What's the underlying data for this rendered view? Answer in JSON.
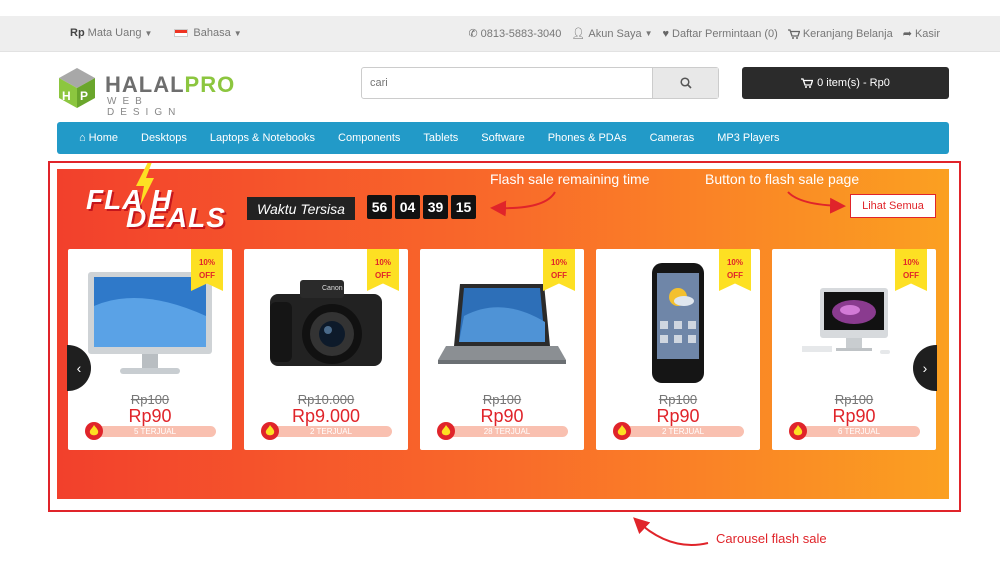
{
  "topbar": {
    "currency_symbol": "Rp",
    "currency_label": "Mata Uang",
    "language_label": "Bahasa",
    "phone": "0813-5883-3040",
    "account": "Akun Saya",
    "wishlist": "Daftar Permintaan (0)",
    "cart_link": "Keranjang Belanja",
    "checkout": "Kasir"
  },
  "logo": {
    "name_part1": "HALAL",
    "name_part2": "PRO",
    "tagline": "WEB DESIGN"
  },
  "search": {
    "placeholder": "cari"
  },
  "cart": {
    "label": "0 item(s) - Rp0"
  },
  "nav": [
    "Home",
    "Desktops",
    "Laptops & Notebooks",
    "Components",
    "Tablets",
    "Software",
    "Phones & PDAs",
    "Cameras",
    "MP3 Players"
  ],
  "flash_sale": {
    "logo_line1": "FLA  H",
    "logo_line2": "DEALS",
    "remaining_label": "Waktu Tersisa",
    "timer": [
      "56",
      "04",
      "39",
      "15"
    ],
    "see_all": "Lihat Semua",
    "products": [
      {
        "image": "monitor-image",
        "discount": "10%",
        "discount_suffix": "OFF",
        "old_price": "Rp100",
        "price": "Rp90",
        "sold": "5 TERJUAL"
      },
      {
        "image": "camera-image",
        "discount": "10%",
        "discount_suffix": "OFF",
        "old_price": "Rp10.000",
        "price": "Rp9.000",
        "sold": "2 TERJUAL"
      },
      {
        "image": "laptop-image",
        "discount": "10%",
        "discount_suffix": "OFF",
        "old_price": "Rp100",
        "price": "Rp90",
        "sold": "28 TERJUAL"
      },
      {
        "image": "phone-image",
        "discount": "10%",
        "discount_suffix": "OFF",
        "old_price": "Rp100",
        "price": "Rp90",
        "sold": "2 TERJUAL"
      },
      {
        "image": "imac-image",
        "discount": "10%",
        "discount_suffix": "OFF",
        "old_price": "Rp100",
        "price": "Rp90",
        "sold": "6 TERJUAL"
      }
    ]
  },
  "annotations": {
    "timer_note": "Flash sale remaining time",
    "button_note": "Button to flash sale page",
    "carousel_note": "Carousel flash sale"
  },
  "colors": {
    "nav": "#229ac8",
    "accent_red": "#e0242a",
    "flash_start": "#f2402c",
    "flash_end": "#fba021",
    "ribbon": "#fde023"
  }
}
